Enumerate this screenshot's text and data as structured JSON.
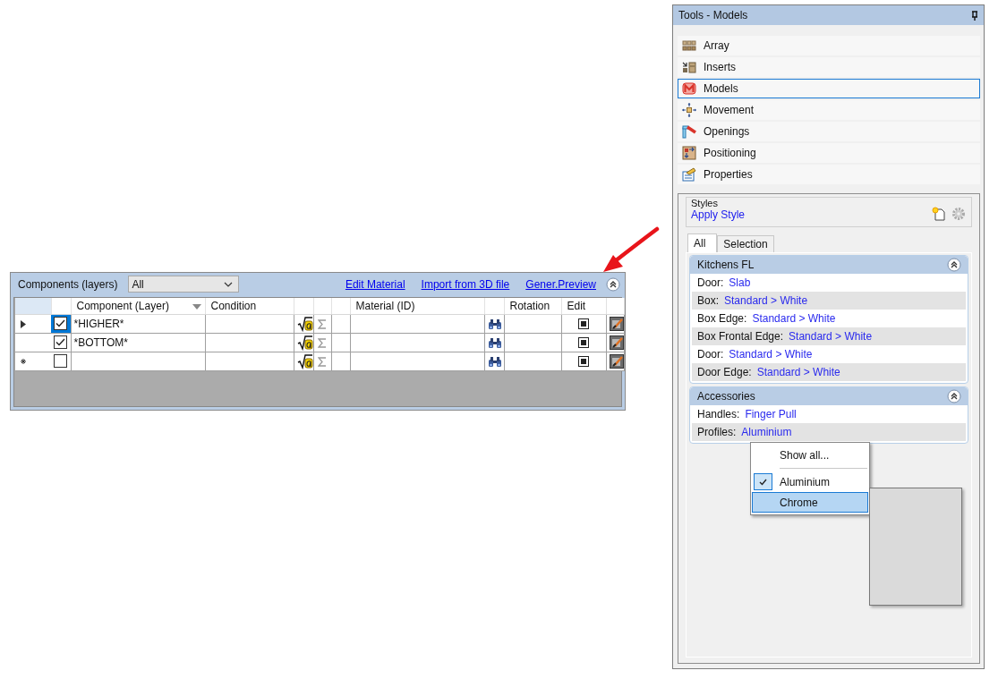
{
  "components_grid": {
    "label": "Components (layers)",
    "filter": {
      "value": "All"
    },
    "links": [
      "Edit Material",
      "Import from 3D file",
      "Gener.Preview"
    ],
    "expanded": true,
    "columns": [
      {
        "kind": "rowhead"
      },
      {
        "kind": "check"
      },
      {
        "kind": "text",
        "label": "Component (Layer)",
        "sorted": true
      },
      {
        "kind": "text",
        "label": "Condition",
        "sorted": false
      },
      {
        "kind": "formula"
      },
      {
        "kind": "sum"
      },
      {
        "kind": "blank"
      },
      {
        "kind": "text",
        "label": "Material (ID)",
        "sorted": false
      },
      {
        "kind": "find"
      },
      {
        "kind": "text",
        "label": "Rotation",
        "sorted": false
      },
      {
        "kind": "edit",
        "label": "Edit"
      },
      {
        "kind": "brush"
      }
    ],
    "rows": [
      {
        "kind": "layer",
        "checked": true,
        "selected": true,
        "component": "*HIGHER*"
      },
      {
        "kind": "layer",
        "checked": true,
        "selected": false,
        "component": "*BOTTOM*"
      },
      {
        "kind": "new",
        "checked": false,
        "selected": false
      }
    ]
  },
  "annotation": {
    "kind": "arrow"
  },
  "tools_panel": {
    "title": "Tools - Models",
    "tools": [
      {
        "label": "Array",
        "selected": false
      },
      {
        "label": "Inserts",
        "selected": false
      },
      {
        "label": "Models",
        "selected": true
      },
      {
        "label": "Movement",
        "selected": false
      },
      {
        "label": "Openings",
        "selected": false
      },
      {
        "label": "Positioning",
        "selected": false
      },
      {
        "label": "Properties",
        "selected": false
      }
    ],
    "styles": {
      "label": "Styles",
      "link": "Apply Style"
    },
    "tabs": [
      {
        "label": "All",
        "selected": true
      },
      {
        "label": "Selection",
        "selected": false
      }
    ],
    "sections": [
      {
        "title": "Kitchens FL",
        "expanded": true,
        "properties": [
          {
            "label": "Door:",
            "value": "Slab"
          },
          {
            "label": "Box:",
            "value": "Standard > White"
          },
          {
            "label": "Box Edge:",
            "value": "Standard > White"
          },
          {
            "label": "Box Frontal Edge:",
            "value": "Standard > White"
          },
          {
            "label": "Door:",
            "value": "Standard > White"
          },
          {
            "label": "Door Edge:",
            "value": "Standard > White"
          }
        ]
      },
      {
        "title": "Accessories",
        "expanded": true,
        "properties": [
          {
            "label": "Handles:",
            "value": "Finger Pull"
          },
          {
            "label": "Profiles:",
            "value": "Aluminium"
          }
        ]
      }
    ],
    "context_menu": {
      "items": [
        {
          "kind": "item",
          "label": "Show all...",
          "checked": false,
          "selected": false
        },
        {
          "kind": "separator"
        },
        {
          "kind": "item",
          "label": "Aluminium",
          "checked": true,
          "selected": false
        },
        {
          "kind": "item",
          "label": "Chrome",
          "checked": false,
          "selected": true
        }
      ]
    }
  }
}
